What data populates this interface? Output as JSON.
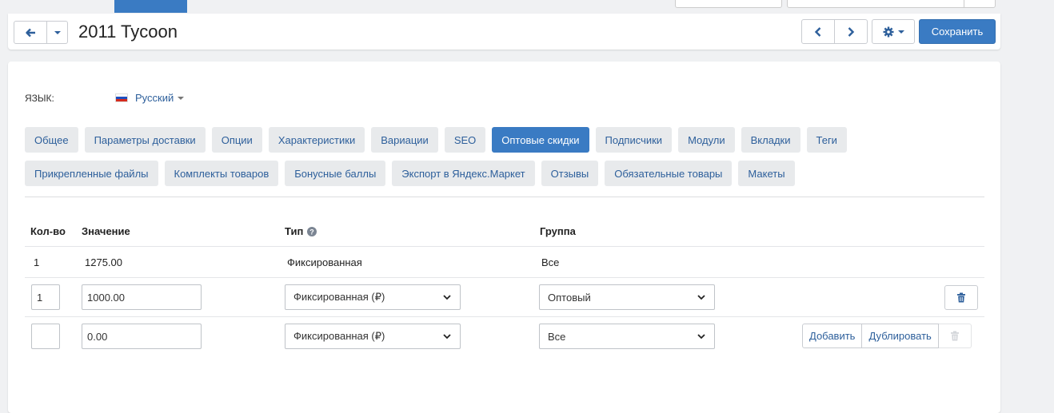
{
  "header": {
    "title": "2011 Tycoon",
    "save_label": "Сохранить"
  },
  "language": {
    "label": "ЯЗЫК:",
    "selected": "Русский"
  },
  "tabs_row1": [
    {
      "label": "Общее",
      "active": false
    },
    {
      "label": "Параметры доставки",
      "active": false
    },
    {
      "label": "Опции",
      "active": false
    },
    {
      "label": "Характеристики",
      "active": false
    },
    {
      "label": "Вариации",
      "active": false
    },
    {
      "label": "SEO",
      "active": false
    },
    {
      "label": "Оптовые скидки",
      "active": true
    },
    {
      "label": "Подписчики",
      "active": false
    },
    {
      "label": "Модули",
      "active": false
    },
    {
      "label": "Вкладки",
      "active": false
    },
    {
      "label": "Теги",
      "active": false
    }
  ],
  "tabs_row2": [
    {
      "label": "Прикрепленные файлы",
      "active": false
    },
    {
      "label": "Комплекты товаров",
      "active": false
    },
    {
      "label": "Бонусные баллы",
      "active": false
    },
    {
      "label": "Экспорт в Яндекс.Маркет",
      "active": false
    },
    {
      "label": "Отзывы",
      "active": false
    },
    {
      "label": "Обязательные товары",
      "active": false
    },
    {
      "label": "Макеты",
      "active": false
    }
  ],
  "table": {
    "headers": {
      "qty": "Кол-во",
      "value": "Значение",
      "type": "Тип",
      "group": "Группа"
    },
    "static_row": {
      "qty": "1",
      "value": "1275.00",
      "type": "Фиксированная",
      "group": "Все"
    },
    "edit_row": {
      "qty": "1",
      "value": "1000.00",
      "type": "Фиксированная (₽)",
      "group": "Оптовый"
    },
    "new_row": {
      "qty": "",
      "value": "0.00",
      "type": "Фиксированная (₽)",
      "group": "Все"
    },
    "add_label": "Добавить",
    "duplicate_label": "Дублировать"
  },
  "colors": {
    "accent": "#3a7bc3",
    "link": "#2d5f9b",
    "tab_bg": "#e8eaec"
  }
}
